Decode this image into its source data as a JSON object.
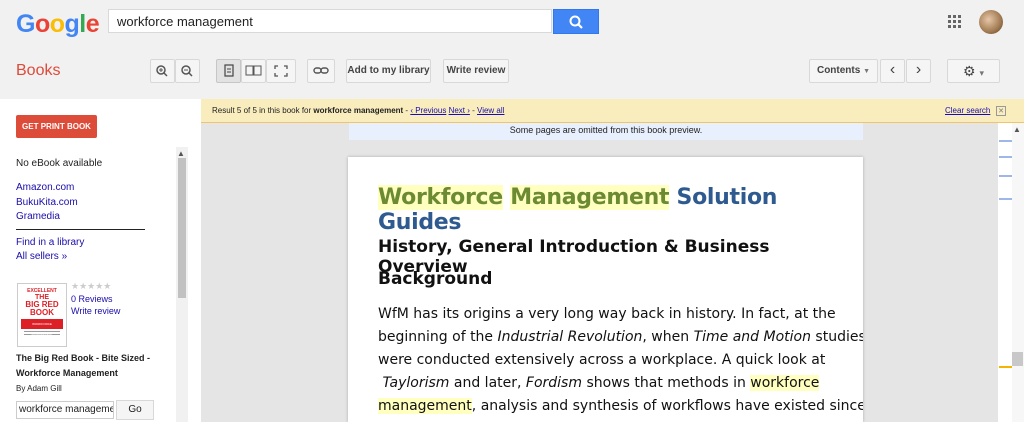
{
  "header": {
    "logo_letters": [
      {
        "ch": "G",
        "color": "#4285f4"
      },
      {
        "ch": "o",
        "color": "#ea4335"
      },
      {
        "ch": "o",
        "color": "#fbbc05"
      },
      {
        "ch": "g",
        "color": "#4285f4"
      },
      {
        "ch": "l",
        "color": "#34a853"
      },
      {
        "ch": "e",
        "color": "#ea4335"
      }
    ],
    "search_value": "workforce management",
    "search_icon": "search-icon",
    "apps_icon": "apps-grid-icon"
  },
  "toolbar": {
    "section_label": "Books",
    "add_library_label": "Add to my library",
    "write_review_label": "Write review",
    "contents_label": "Contents",
    "contents_arrow": "▼",
    "prev_label": "‹",
    "next_label": "›",
    "settings_icon": "⚙",
    "settings_arrow": "▾"
  },
  "notice": {
    "prefix": "Result 5 of 5 in this book for ",
    "query": "workforce management",
    "sep1": " - ",
    "prev": "‹ Previous",
    "next": "Next ›",
    "sep2": " - ",
    "view_all": "View all",
    "clear": "Clear search",
    "close": "✕"
  },
  "sidebar": {
    "print_button": "GET PRINT BOOK",
    "no_ebook": "No eBook available",
    "sellers": [
      "Amazon.com",
      "BukuKita.com",
      "Gramedia"
    ],
    "find_library": "Find in a library",
    "all_sellers": "All sellers »",
    "stars": "★★★★★",
    "reviews_count": "0 Reviews",
    "write_review": "Write review",
    "book_title_line1": "The Big Red Book - Bite Sized -",
    "book_title_line2": "Workforce Management",
    "author": "By Adam Gill",
    "search_in_book_value": "workforce manageme",
    "go_label": "Go",
    "cover": {
      "brand": "EXCELLENT",
      "line1": "THE",
      "line2": "BIG RED",
      "line3": "BOOK",
      "subtitle": "WORKFORCE MANAGEMENT"
    }
  },
  "viewer": {
    "omitted_notice": "Some pages are omitted from this book preview.",
    "title_word1": "Workforce",
    "title_word2": "Management",
    "title_rest": "Solution Guides",
    "heading_line1": "History, General Introduction & Business Overview",
    "heading_line2": "Background",
    "para_lines": {
      "l1": "WfM has its origins a very long way back in history.  In fact, at the",
      "l2a": "beginning of the ",
      "l2b": "Industrial Revolution",
      "l2c": ",  when  ",
      "l2d": "Time  and  Motion",
      "l2e": " studies",
      "l3": "were conducted extensively across a workplace.  A quick look at",
      "l4a": "Taylorism",
      "l4b": "  and   later,   ",
      "l4c": "Fordism",
      "l4d": " shows that methods in ",
      "l4e": "workforce",
      "l5a": "management",
      "l5b": ", analysis and synthesis of workflows have existed since the"
    }
  }
}
